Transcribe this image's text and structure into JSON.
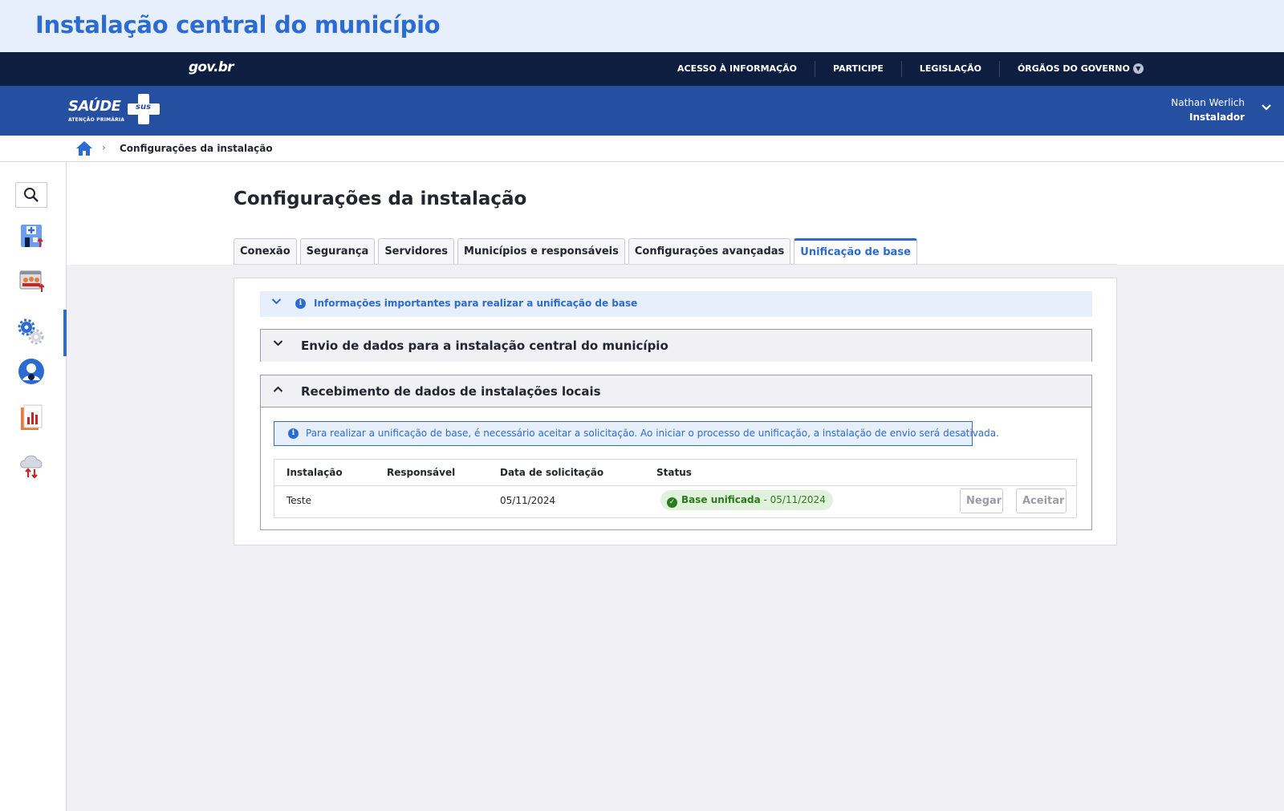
{
  "banner": {
    "title": "Instalação central do município"
  },
  "govbar": {
    "logo": "gov.br",
    "links": [
      "ACESSO À INFORMAÇÃO",
      "PARTICIPE",
      "LEGISLAÇÃO",
      "ÓRGÃOS DO GOVERNO"
    ]
  },
  "header": {
    "brand": {
      "name": "SAÚDE",
      "badge": "sus",
      "subtitle": "ATENÇÃO PRIMÁRIA"
    },
    "user": {
      "name": "Nathan Werlich",
      "role": "Instalador"
    }
  },
  "breadcrumb": {
    "current": "Configurações da instalação"
  },
  "sidebar": {
    "items": [
      "search-icon",
      "health-unit-icon",
      "reception-icon",
      "settings-icon",
      "user-account-icon",
      "reports-icon",
      "cloud-sync-icon"
    ],
    "active_index": 3
  },
  "page": {
    "title": "Configurações da instalação",
    "tabs": [
      "Conexão",
      "Segurança",
      "Servidores",
      "Municípios e responsáveis",
      "Configurações avançadas",
      "Unificação de base"
    ],
    "active_tab": "Unificação de base"
  },
  "panel": {
    "info_strip": "Informações importantes para realizar a unificação de base",
    "accordion_send": "Envio de dados para a instalação central do município",
    "accordion_receive": "Recebimento de dados de instalações locais",
    "alert": "Para realizar a unificação de base, é necessário aceitar a solicitação. Ao iniciar o processo de unificação, a instalação de envio será desativada.",
    "table": {
      "headers": [
        "Instalação",
        "Responsável",
        "Data de solicitação",
        "Status"
      ],
      "rows": [
        {
          "installation": "Teste",
          "responsible": "",
          "date": "05/11/2024",
          "status": "Base unificada",
          "status_date": " - 05/11/2024",
          "deny": "Negar",
          "accept": "Aceitar"
        }
      ]
    }
  },
  "colors": {
    "primary": "#2c6bcf",
    "header": "#2550a2",
    "govbar": "#0e1e40",
    "success": "#2b7a1b"
  }
}
